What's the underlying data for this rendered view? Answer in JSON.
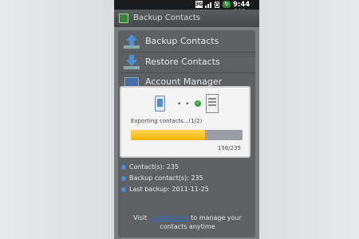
{
  "status_bar": {
    "network": "3G",
    "time": "9:44 AM"
  },
  "title_bar": {
    "title": "Backup Contacts"
  },
  "menu": [
    {
      "label": "Backup Contacts",
      "icon": "upload-icon"
    },
    {
      "label": "Restore Contacts",
      "icon": "download-icon"
    },
    {
      "label": "Account Manager",
      "icon": "account-icon"
    }
  ],
  "dialog": {
    "status": "Exporting contacts...(1/2)",
    "progress_fraction": 0.664,
    "count": "156/235"
  },
  "info": {
    "contacts": "Contact(s): 235",
    "backup_contacts": "Backup contact(s): 235",
    "last_backup": "Last backup: 2011-11-25"
  },
  "footer": {
    "prefix": "Visit ",
    "link": "i.netqin.com",
    "suffix": " to manage your contacts anytime"
  },
  "colors": {
    "accent": "#4a90d9",
    "progress": "#f2b400",
    "link": "#2d6fd0"
  }
}
